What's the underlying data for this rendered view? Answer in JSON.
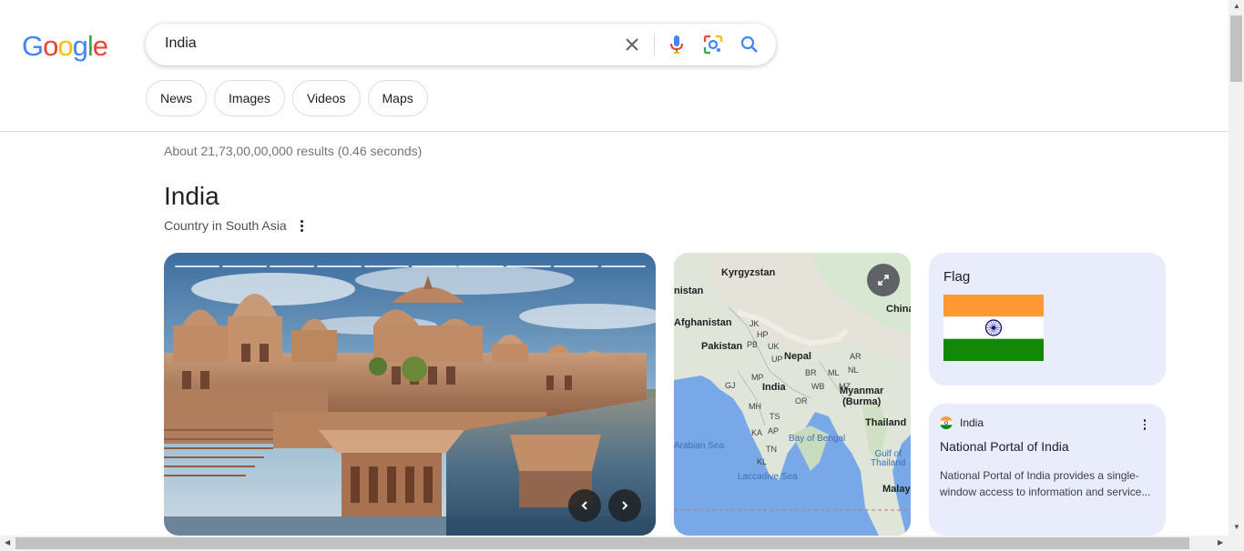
{
  "logo": {
    "text": "Google"
  },
  "search": {
    "query": "India"
  },
  "icons": {
    "clear": "close-icon",
    "voice": "microphone-icon",
    "lens": "camera-lens-icon",
    "submit": "search-icon"
  },
  "chips": [
    "News",
    "Images",
    "Videos",
    "Maps"
  ],
  "stats": "About 21,73,00,00,000 results (0.46 seconds)",
  "knowledge_panel": {
    "title": "India",
    "subtitle": "Country in South Asia"
  },
  "map_labels": {
    "kyrgyzstan": "Kyrgyzstan",
    "nistan": "nistan",
    "china": "China",
    "afghanistan": "Afghanistan",
    "pakistan": "Pakistan",
    "nepal": "Nepal",
    "india": "India",
    "myanmar": "Myanmar\n(Burma)",
    "thailand": "Thailand",
    "arabian_sea": "Arabian Sea",
    "bay_of_bengal": "Bay of Bengal",
    "gulf_of_thailand": "Gulf of\nThailand",
    "laccadive_sea": "Laccadive Sea",
    "malay": "Malay",
    "jk": "JK",
    "hp": "HP",
    "pb": "PB",
    "uk": "UK",
    "up": "UP",
    "gj": "GJ",
    "mp": "MP",
    "br": "BR",
    "ml": "ML",
    "nl": "NL",
    "ar": "AR",
    "wb": "WB",
    "or": "OR",
    "mh": "MH",
    "ts": "TS",
    "ap": "AP",
    "ka": "KA",
    "tn": "TN",
    "kl": "KL",
    "mz": "MZ"
  },
  "flag_card": {
    "title": "Flag",
    "colors": {
      "saffron": "#ff9933",
      "white": "#ffffff",
      "green": "#138808",
      "chakra": "#000080"
    }
  },
  "portal_card": {
    "source": "India",
    "name": "National Portal of India",
    "description": "National Portal of India provides a single-window access to information and service..."
  },
  "colors": {
    "blue": "#4285f4",
    "red": "#ea4335",
    "yellow": "#fbbc05",
    "green": "#34a853",
    "card_bg": "#e8ecfb"
  }
}
